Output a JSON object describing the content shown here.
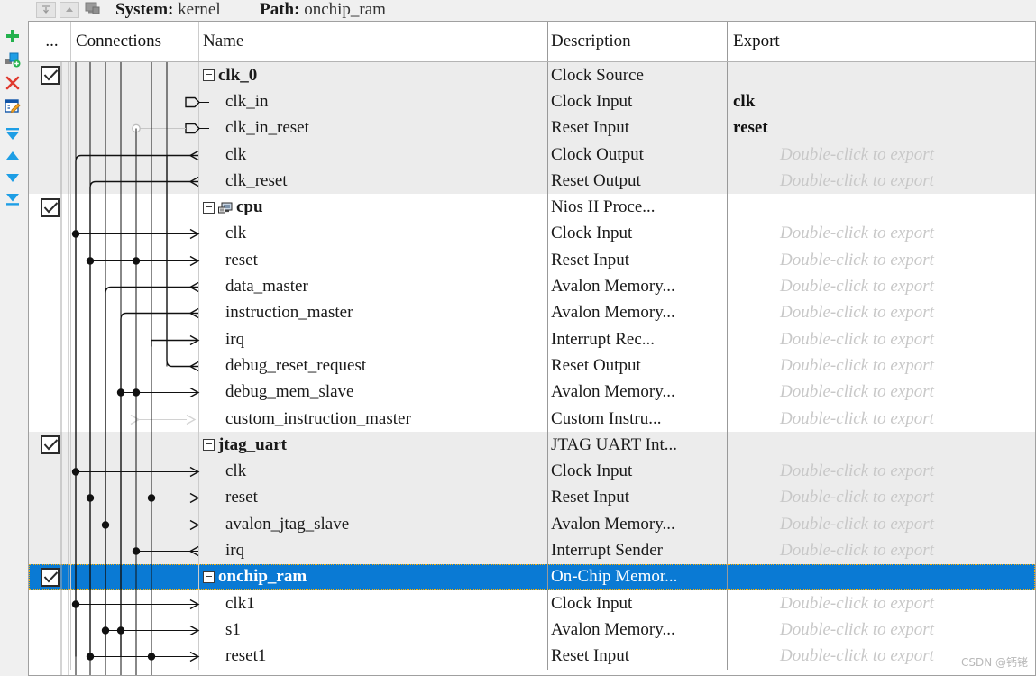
{
  "header": {
    "system_label": "System:",
    "system_value": "kernel",
    "path_label": "Path:",
    "path_value": "onchip_ram",
    "buttons": [
      {
        "name": "collapse-all-icon",
        "label": ""
      },
      {
        "name": "expand-up-icon",
        "label": ""
      },
      {
        "name": "system-icon",
        "label": ""
      }
    ]
  },
  "rail": {
    "items": [
      {
        "name": "add-icon",
        "label": "Add",
        "color": "#23b14d"
      },
      {
        "name": "add-component-icon",
        "label": "New component",
        "color": "#0c8ee0"
      },
      {
        "name": "remove-icon",
        "label": "Remove",
        "color": "#e03a2f"
      },
      {
        "name": "edit-icon",
        "label": "Edit",
        "color": "#1155a8"
      },
      {
        "name": "move-to-top-icon",
        "label": "Move to top",
        "color": "#1e9ee5"
      },
      {
        "name": "move-up-icon",
        "label": "Move up",
        "color": "#1e9ee5"
      },
      {
        "name": "move-down-icon",
        "label": "Move down",
        "color": "#1e9ee5"
      },
      {
        "name": "move-to-bottom-icon",
        "label": "Move to bottom",
        "color": "#1e9ee5"
      }
    ]
  },
  "table": {
    "columns": [
      "...",
      "Connections",
      "Name",
      "Description",
      "Export"
    ],
    "export_placeholder": "Double-click to export",
    "rows": [
      {
        "use": true,
        "checkbox": true,
        "name": "clk_0",
        "level": 0,
        "icon": "expand-box",
        "desc": "Clock Source",
        "export": "",
        "alt": true,
        "selected": false
      },
      {
        "use": false,
        "checkbox": false,
        "name": "clk_in",
        "level": 1,
        "icon": "",
        "desc": "Clock Input",
        "export": "clk",
        "alt": true,
        "selected": false
      },
      {
        "use": false,
        "checkbox": false,
        "name": "clk_in_reset",
        "level": 1,
        "icon": "",
        "desc": "Reset Input",
        "export": "reset",
        "alt": true,
        "selected": false
      },
      {
        "use": false,
        "checkbox": false,
        "name": "clk",
        "level": 1,
        "icon": "",
        "desc": "Clock Output",
        "export": "hint",
        "alt": true,
        "selected": false
      },
      {
        "use": false,
        "checkbox": false,
        "name": "clk_reset",
        "level": 1,
        "icon": "",
        "desc": "Reset Output",
        "export": "hint",
        "alt": true,
        "selected": false
      },
      {
        "use": true,
        "checkbox": true,
        "name": "cpu",
        "level": 0,
        "icon": "expand-box-cpu",
        "desc": "Nios II Proce...",
        "export": "",
        "alt": false,
        "selected": false
      },
      {
        "use": false,
        "checkbox": false,
        "name": "clk",
        "level": 1,
        "icon": "",
        "desc": "Clock Input",
        "export": "hint",
        "alt": false,
        "selected": false
      },
      {
        "use": false,
        "checkbox": false,
        "name": "reset",
        "level": 1,
        "icon": "",
        "desc": "Reset Input",
        "export": "hint",
        "alt": false,
        "selected": false
      },
      {
        "use": false,
        "checkbox": false,
        "name": "data_master",
        "level": 1,
        "icon": "",
        "desc": "Avalon Memory...",
        "export": "hint",
        "alt": false,
        "selected": false
      },
      {
        "use": false,
        "checkbox": false,
        "name": "instruction_master",
        "level": 1,
        "icon": "",
        "desc": "Avalon Memory...",
        "export": "hint",
        "alt": false,
        "selected": false
      },
      {
        "use": false,
        "checkbox": false,
        "name": "irq",
        "level": 1,
        "icon": "",
        "desc": "Interrupt Rec...",
        "export": "hint",
        "alt": false,
        "selected": false
      },
      {
        "use": false,
        "checkbox": false,
        "name": "debug_reset_request",
        "level": 1,
        "icon": "",
        "desc": "Reset Output",
        "export": "hint",
        "alt": false,
        "selected": false
      },
      {
        "use": false,
        "checkbox": false,
        "name": "debug_mem_slave",
        "level": 1,
        "icon": "",
        "desc": "Avalon Memory...",
        "export": "hint",
        "alt": false,
        "selected": false
      },
      {
        "use": false,
        "checkbox": false,
        "name": "custom_instruction_master",
        "level": 1,
        "icon": "",
        "desc": "Custom Instru...",
        "export": "hint",
        "alt": false,
        "selected": false
      },
      {
        "use": true,
        "checkbox": true,
        "name": "jtag_uart",
        "level": 0,
        "icon": "expand-box",
        "desc": "JTAG UART Int...",
        "export": "",
        "alt": true,
        "selected": false
      },
      {
        "use": false,
        "checkbox": false,
        "name": "clk",
        "level": 1,
        "icon": "",
        "desc": "Clock Input",
        "export": "hint",
        "alt": true,
        "selected": false
      },
      {
        "use": false,
        "checkbox": false,
        "name": "reset",
        "level": 1,
        "icon": "",
        "desc": "Reset Input",
        "export": "hint",
        "alt": true,
        "selected": false
      },
      {
        "use": false,
        "checkbox": false,
        "name": "avalon_jtag_slave",
        "level": 1,
        "icon": "",
        "desc": "Avalon Memory...",
        "export": "hint",
        "alt": true,
        "selected": false
      },
      {
        "use": false,
        "checkbox": false,
        "name": "irq",
        "level": 1,
        "icon": "",
        "desc": "Interrupt Sender",
        "export": "hint",
        "alt": true,
        "selected": false
      },
      {
        "use": true,
        "checkbox": true,
        "name": "onchip_ram",
        "level": 0,
        "icon": "expand-box",
        "desc": "On-Chip Memor...",
        "export": "",
        "alt": false,
        "selected": true
      },
      {
        "use": false,
        "checkbox": false,
        "name": "clk1",
        "level": 1,
        "icon": "",
        "desc": "Clock Input",
        "export": "hint",
        "alt": false,
        "selected": false
      },
      {
        "use": false,
        "checkbox": false,
        "name": "s1",
        "level": 1,
        "icon": "",
        "desc": "Avalon Memory...",
        "export": "hint",
        "alt": false,
        "selected": false
      },
      {
        "use": false,
        "checkbox": false,
        "name": "reset1",
        "level": 1,
        "icon": "",
        "desc": "Reset Input",
        "export": "hint",
        "alt": false,
        "selected": false
      }
    ]
  },
  "watermark": "CSDN @钙铑",
  "colors": {
    "selection": "#0a7ad4",
    "alt_row": "#ececec",
    "hint_text": "#c8c8c8",
    "grid_line": "#cccccc"
  }
}
